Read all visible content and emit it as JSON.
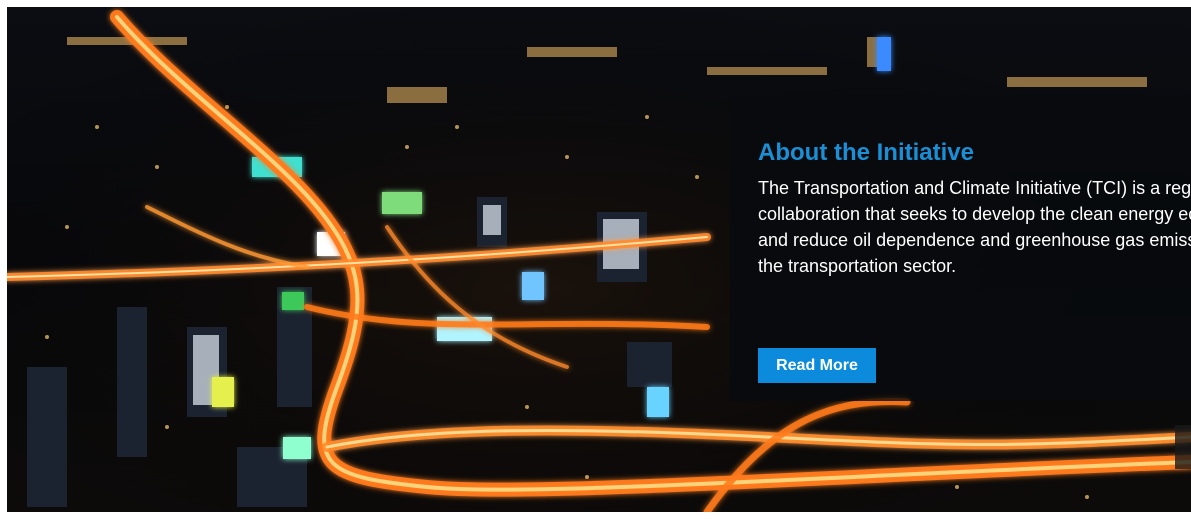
{
  "hero": {
    "image_icon": "night-city-highway-image",
    "accent_color": "#1a8fd6",
    "title": "About the Initiative",
    "body": "The Transportation and Climate Initiative (TCI) is a regional collaboration that seeks to develop the clean energy economy and reduce oil dependence and greenhouse gas emissions from the transportation sector.",
    "button_label": "Read More",
    "button_color": "#0c8bdc",
    "arrow_icon": "next-arrow-icon"
  }
}
